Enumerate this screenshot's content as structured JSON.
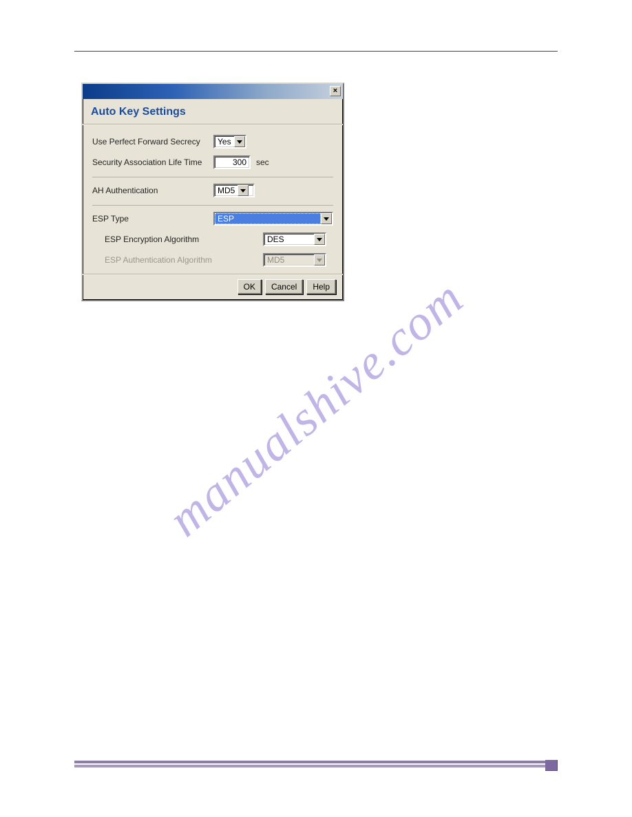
{
  "watermark": "manualshive.com",
  "dialog": {
    "title": "Auto Key Settings",
    "pfs_label": "Use Perfect Forward Secrecy",
    "pfs_value": "Yes",
    "lifetime_label": "Security Association Life Time",
    "lifetime_value": "300",
    "lifetime_unit": "sec",
    "ah_label": "AH Authentication",
    "ah_value": "MD5",
    "esp_type_label": "ESP Type",
    "esp_type_value": "ESP",
    "esp_enc_label": "ESP Encryption Algorithm",
    "esp_enc_value": "DES",
    "esp_auth_label": "ESP Authentication Algorithm",
    "esp_auth_value": "MD5",
    "ok": "OK",
    "cancel": "Cancel",
    "help": "Help"
  }
}
